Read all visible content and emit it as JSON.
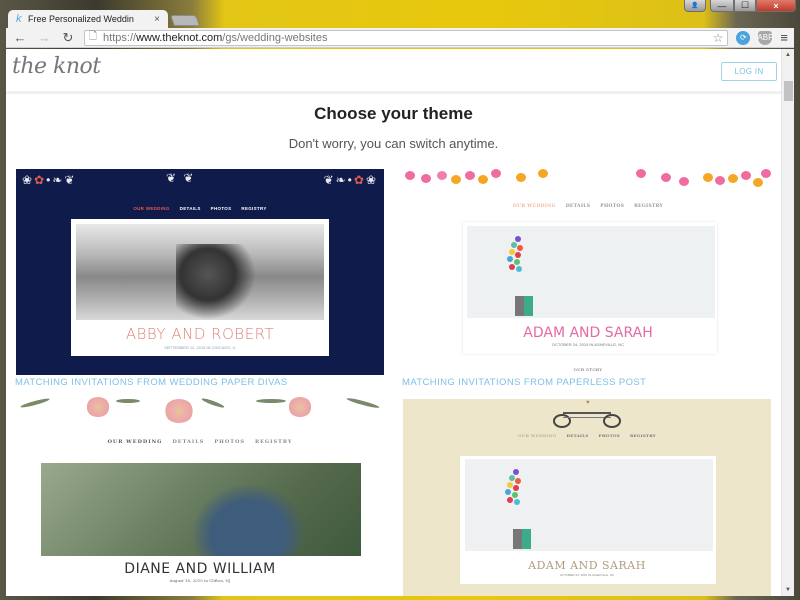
{
  "browser": {
    "tab_title": "Free Personalized Weddin",
    "tab_close": "×",
    "url_scheme": "https://",
    "url_host": "www.theknot.com",
    "url_path": "/gs/wedding-websites",
    "icons": {
      "back": "←",
      "forward": "→",
      "reload": "↻",
      "page": "🗋",
      "star": "☆",
      "menu": "≡",
      "sync": "⟳",
      "extension": "ABP",
      "user": "👤",
      "minimize": "—",
      "maximize": "☐",
      "close": "×"
    }
  },
  "header": {
    "logo": "the knot",
    "login_label": "LOG IN"
  },
  "main": {
    "title": "Choose your theme",
    "subtitle": "Don't worry, you can switch anytime."
  },
  "themes": [
    {
      "nav": [
        "OUR WEDDING",
        "DETAILS",
        "PHOTOS",
        "REGISTRY"
      ],
      "names": "ABBY AND ROBERT",
      "date": "SEPTEMBER 12, 2015 IN CHICAGO, IL",
      "link": "MATCHING INVITATIONS FROM WEDDING PAPER DIVAS",
      "accent": "#0f1b4a"
    },
    {
      "nav": [
        "OUR WEDDING",
        "DETAILS",
        "PHOTOS",
        "REGISTRY"
      ],
      "names": "ADAM AND SARAH",
      "date": "OCTOBER 24, 2015 IN ASHEVILLE, NC",
      "story": "OUR STORY",
      "link": "MATCHING INVITATIONS FROM PAPERLESS POST",
      "accent": "#e46aa4"
    },
    {
      "nav": [
        "OUR WEDDING",
        "DETAILS",
        "PHOTOS",
        "REGISTRY"
      ],
      "names": "DIANE AND WILLIAM",
      "date": "August 18, 2015 in Clifton, NJ",
      "accent": "#e9a5a2"
    },
    {
      "nav": [
        "OUR WEDDING",
        "DETAILS",
        "PHOTOS",
        "REGISTRY"
      ],
      "names": "ADAM AND SARAH",
      "date": "OCTOBER 24, 2015 IN ASHEVILLE, NC",
      "accent": "#eee6cb"
    }
  ],
  "scrollbar": {
    "up": "▲",
    "down": "▼",
    "position_fraction": 0.05
  }
}
